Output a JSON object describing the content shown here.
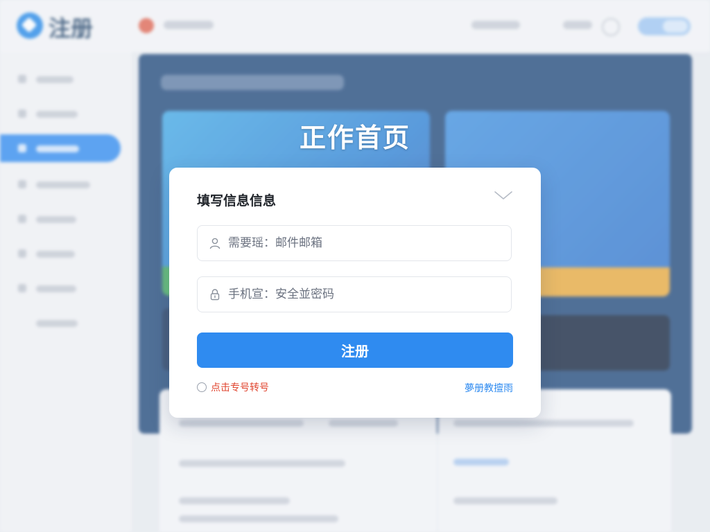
{
  "app": {
    "logo_text": "注册"
  },
  "page": {
    "heading": "正作首页"
  },
  "modal": {
    "title": "填写信息信息",
    "email_field": {
      "placeholder": "需要瑶：邮件邮箱"
    },
    "password_field": {
      "placeholder": "手机宣：安全並密码"
    },
    "submit_label": "注册",
    "agree_text": "点击专号转号",
    "help_link": "夢册教擅雨"
  },
  "colors": {
    "accent": "#2f8bf0",
    "warning_text": "#e0452f"
  },
  "icons": {
    "logo": "logo-icon",
    "user": "user-icon",
    "lock": "lock-icon",
    "collapse": "chevron-down-icon"
  }
}
